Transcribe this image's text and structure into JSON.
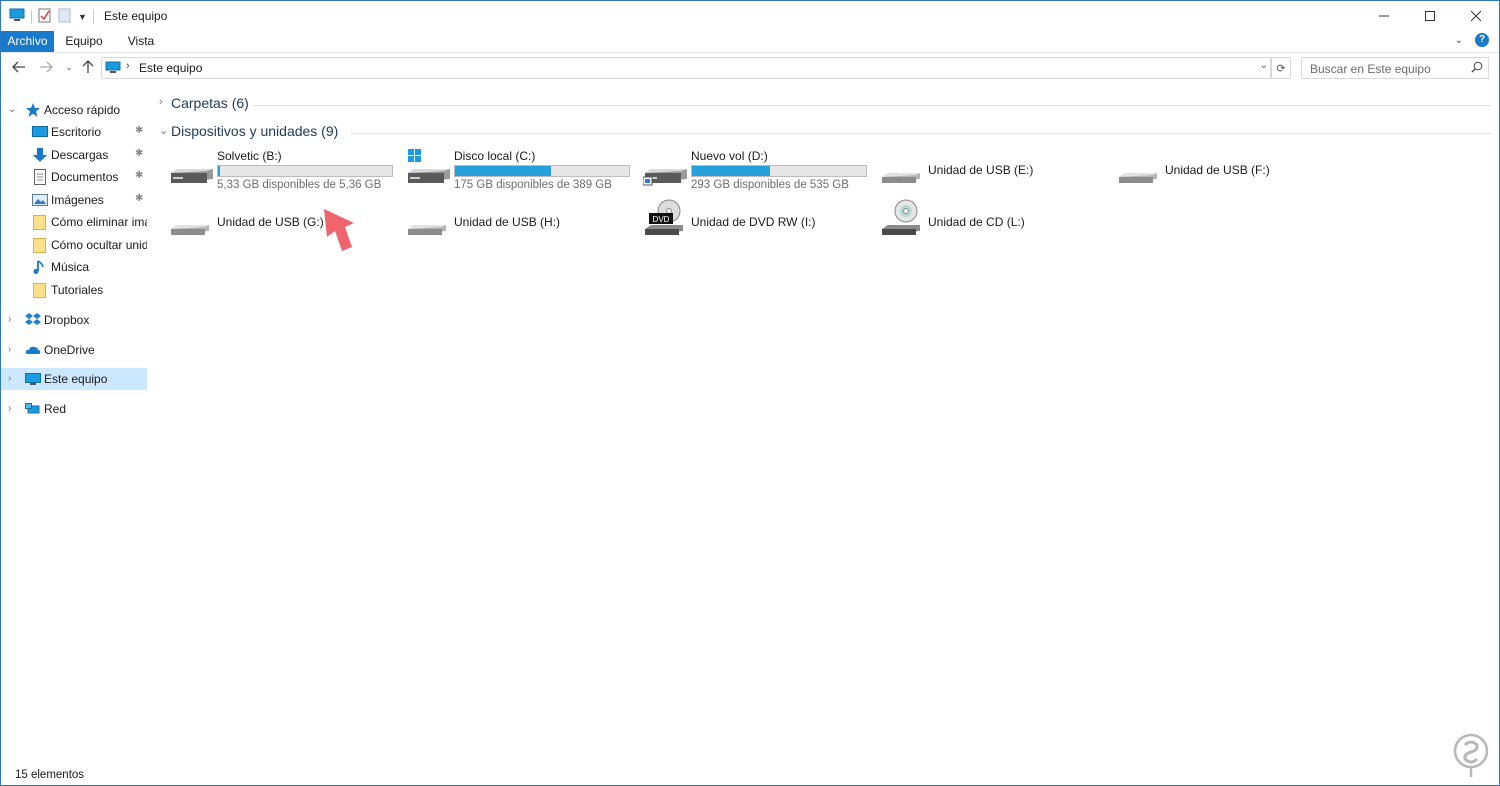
{
  "window": {
    "title": "Este equipo"
  },
  "ribbon": {
    "tabs": [
      {
        "label": "Archivo",
        "active": true
      },
      {
        "label": "Equipo"
      },
      {
        "label": "Vista"
      }
    ],
    "help_label": "?"
  },
  "address": {
    "path": "Este equipo",
    "search_placeholder": "Buscar en Este equipo"
  },
  "sidebar": {
    "quick_access": "Acceso rápido",
    "items": [
      {
        "label": "Escritorio",
        "icon": "desktop-icon",
        "pinned": true
      },
      {
        "label": "Descargas",
        "icon": "download-icon",
        "pinned": true
      },
      {
        "label": "Documentos",
        "icon": "document-icon",
        "pinned": true
      },
      {
        "label": "Imágenes",
        "icon": "picture-icon",
        "pinned": true
      },
      {
        "label": "Cómo eliminar ima",
        "icon": "folder-icon"
      },
      {
        "label": "Cómo ocultar unida",
        "icon": "folder-icon"
      },
      {
        "label": "Música",
        "icon": "music-icon"
      },
      {
        "label": "Tutoriales",
        "icon": "folder-icon"
      }
    ],
    "roots": [
      {
        "label": "Dropbox",
        "icon": "dropbox-icon"
      },
      {
        "label": "OneDrive",
        "icon": "onedrive-icon"
      },
      {
        "label": "Este equipo",
        "icon": "pc-icon",
        "selected": true
      },
      {
        "label": "Red",
        "icon": "network-icon"
      }
    ]
  },
  "content": {
    "groups": [
      {
        "title": "Carpetas (6)",
        "expanded": false
      },
      {
        "title": "Dispositivos y unidades (9)",
        "expanded": true
      }
    ],
    "drives": [
      {
        "name": "Solvetic (B:)",
        "free": "5,33 GB disponibles de 5,36 GB",
        "used_fraction": 0.006,
        "icon": "hdd-icon"
      },
      {
        "name": "Disco local (C:)",
        "free": "175 GB disponibles de 389 GB",
        "used_fraction": 0.55,
        "icon": "windows-drive-icon"
      },
      {
        "name": "Nuevo vol (D:)",
        "free": "293 GB disponibles de 535 GB",
        "used_fraction": 0.45,
        "icon": "hdd-icon"
      },
      {
        "name": "Unidad de USB (E:)",
        "icon": "usb-drive-icon"
      },
      {
        "name": "Unidad de USB (F:)",
        "icon": "usb-drive-icon"
      },
      {
        "name": "Unidad de USB (G:)",
        "icon": "usb-drive-icon"
      },
      {
        "name": "Unidad de USB (H:)",
        "icon": "usb-drive-icon"
      },
      {
        "name": "Unidad de DVD RW (I:)",
        "icon": "dvd-drive-icon",
        "badge": "DVD"
      },
      {
        "name": "Unidad de CD (L:)",
        "icon": "cd-drive-icon"
      }
    ]
  },
  "status": {
    "count": "15 elementos"
  },
  "colors": {
    "accent": "#1979ca",
    "bar_fill": "#26a0da",
    "selected": "#cce8ff",
    "arrow": "#f0646e"
  }
}
